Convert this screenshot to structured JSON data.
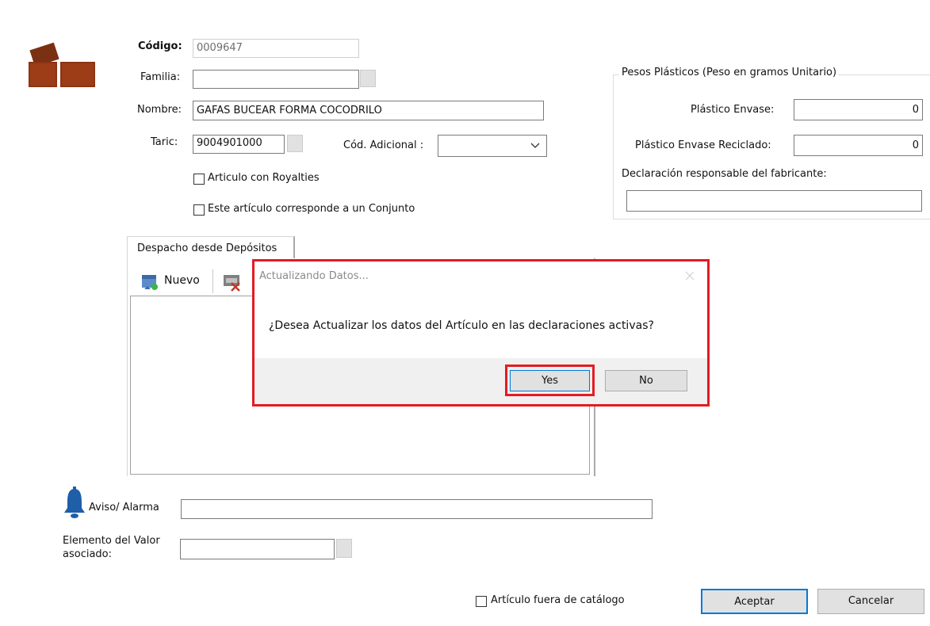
{
  "header": {
    "icon": "bricks-icon",
    "code_label": "Código:",
    "code_value": "0009647",
    "familia_label": "Familia:",
    "familia_value": "",
    "nombre_label": "Nombre:",
    "nombre_value": "GAFAS BUCEAR FORMA COCODRILO",
    "taric_label": "Taric:",
    "taric_value": "9004901000",
    "cod_adicional_label": "Cód. Adicional :",
    "cod_adicional_value": "",
    "royalties_label": "Articulo con Royalties",
    "conjunto_label": "Este artículo corresponde a un Conjunto"
  },
  "pesos": {
    "title": "Pesos Plásticos (Peso en gramos Unitario)",
    "envase_label": "Plástico Envase:",
    "envase_value": "0",
    "reciclado_label": "Plástico Envase Reciclado:",
    "reciclado_value": "0",
    "declaracion_label": "Declaración responsable del fabricante:",
    "declaracion_value": ""
  },
  "tabs": {
    "despacho_label": "Despacho desde Depósitos",
    "nuevo_label": "Nuevo"
  },
  "dialog": {
    "title": "Actualizando Datos...",
    "message": "¿Desea Actualizar los datos del Artículo en las declaraciones activas?",
    "yes_label": "Yes",
    "no_label": "No",
    "highlight_color": "#e31b23"
  },
  "bottom": {
    "aviso_label": "Aviso/ Alarma",
    "aviso_value": "",
    "elemento_label_line1": "Elemento del Valor",
    "elemento_label_line2": "asociado:",
    "elemento_value": "",
    "fuera_catalogo_label": "Artículo fuera de catálogo",
    "aceptar_label": "Aceptar",
    "cancelar_label": "Cancelar"
  }
}
